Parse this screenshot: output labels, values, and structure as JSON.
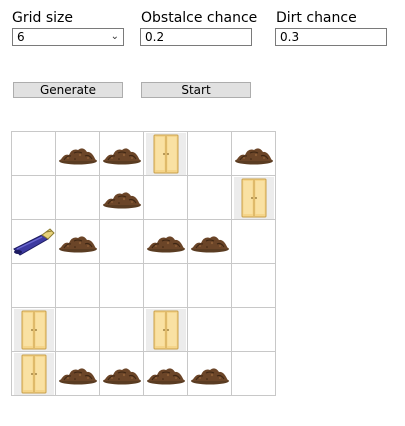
{
  "controls": {
    "grid_size_label": "Grid size",
    "grid_size_value": "6",
    "obstacle_label": "Obstalce chance",
    "obstacle_value": "0.2",
    "dirt_label": "Dirt chance",
    "dirt_value": "0.3",
    "generate_label": "Generate",
    "start_label": "Start"
  },
  "grid": {
    "size": 6,
    "cells": [
      [
        "empty",
        "dirt",
        "dirt",
        "cabinet",
        "empty",
        "dirt"
      ],
      [
        "empty",
        "empty",
        "dirt",
        "empty",
        "empty",
        "cabinet"
      ],
      [
        "vacuum",
        "dirt",
        "empty",
        "dirt",
        "dirt",
        "empty"
      ],
      [
        "empty",
        "empty",
        "empty",
        "empty",
        "empty",
        "empty"
      ],
      [
        "cabinet",
        "empty",
        "empty",
        "cabinet",
        "empty",
        "empty"
      ],
      [
        "cabinet",
        "dirt",
        "dirt",
        "dirt",
        "dirt",
        "empty"
      ]
    ]
  },
  "icons": {
    "dirt": "dirt-pile-icon",
    "cabinet": "wardrobe-obstacle-icon",
    "vacuum": "vacuum-robot-icon"
  }
}
